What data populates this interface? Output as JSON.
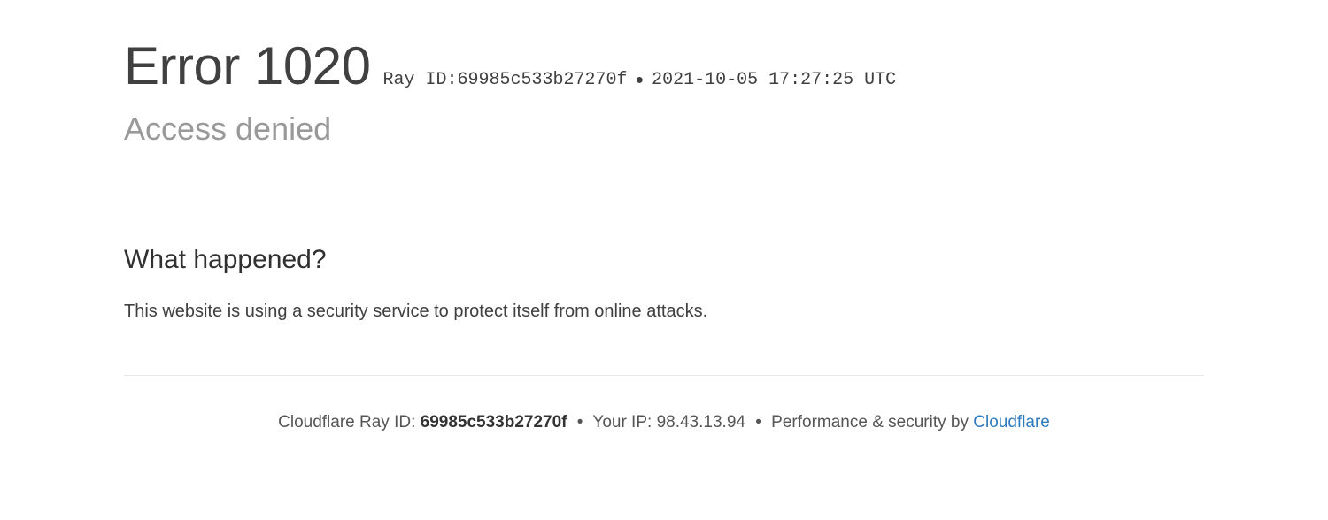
{
  "header": {
    "error_title": "Error 1020",
    "ray_label": "Ray ID: ",
    "ray_id": "69985c533b27270f",
    "timestamp": "2021-10-05 17:27:25 UTC",
    "subtitle": "Access denied"
  },
  "section": {
    "heading": "What happened?",
    "body": "This website is using a security service to protect itself from online attacks."
  },
  "footer": {
    "ray_label": "Cloudflare Ray ID: ",
    "ray_id": "69985c533b27270f",
    "ip_label": "Your IP: ",
    "ip": "98.43.13.94",
    "perf_label": "Performance & security by ",
    "perf_link": "Cloudflare"
  }
}
